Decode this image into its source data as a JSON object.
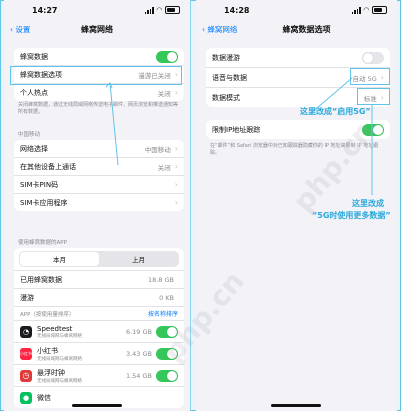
{
  "left": {
    "time": "14:27",
    "back_label": "设置",
    "title": "蜂窝网络",
    "rows_top": [
      {
        "label": "蜂窝数据",
        "toggle": true
      },
      {
        "label": "蜂窝数据选项",
        "value": "漫游已关闭"
      },
      {
        "label": "个人热点",
        "value": "关闭"
      }
    ],
    "note1": "关闭蜂窝数据，通过无线局域网络传送电子邮件、网页浏览和推送通知等所有数据。",
    "carrier_header": "中国移动",
    "rows_carrier": [
      {
        "label": "网络选择",
        "value": "中国移动"
      },
      {
        "label": "在其他设备上通话",
        "value": "关闭"
      },
      {
        "label": "SIM卡PIN码",
        "value": ""
      },
      {
        "label": "SIM卡应用程序",
        "value": ""
      }
    ],
    "usage_header": "使用蜂窝数据的APP",
    "seg": [
      "本月",
      "上月"
    ],
    "usage_rows": [
      {
        "label": "已用蜂窝数据",
        "value": "18.8 GB"
      },
      {
        "label": "漫游",
        "value": "0 KB"
      }
    ],
    "app_header": "APP（按使用量排序）",
    "app_sort": "按名称排序",
    "apps": [
      {
        "name": "Speedtest",
        "sub": "无线局域网与蜂窝网络",
        "value": "6.19 GB",
        "color": "#1b1b1f"
      },
      {
        "name": "小红书",
        "sub": "无线局域网与蜂窝网络",
        "value": "3.43 GB",
        "color": "#ff2442"
      },
      {
        "name": "悬浮时钟",
        "sub": "无线局域网与蜂窝网络",
        "value": "1.54 GB",
        "color": "#e03a3a"
      },
      {
        "name": "微信",
        "sub": "",
        "value": "",
        "color": "#07c160"
      }
    ]
  },
  "right": {
    "time": "14:28",
    "back_label": "蜂窝网络",
    "title": "蜂窝数据选项",
    "rows": [
      {
        "label": "数据漫游",
        "toggle": false
      },
      {
        "label": "语音与数据",
        "value": "自动 5G"
      },
      {
        "label": "数据模式",
        "value": "标准"
      }
    ],
    "rows2": [
      {
        "label": "限制IP地址跟踪",
        "toggle": true
      }
    ],
    "note": "在“邮件”和 Safari 浏览器中对已知跟踪器隐藏你的 IP 地址来限制 IP 地址跟踪。"
  },
  "annotations": {
    "a1": "这里改成“启用5G”",
    "a2_line1": "这里改成",
    "a2_line2": "“5G时使用更多数据”"
  },
  "watermark": "php.cn",
  "colors": {
    "accent": "#5fc4e8",
    "green": "#34c759",
    "link": "#007aff"
  }
}
